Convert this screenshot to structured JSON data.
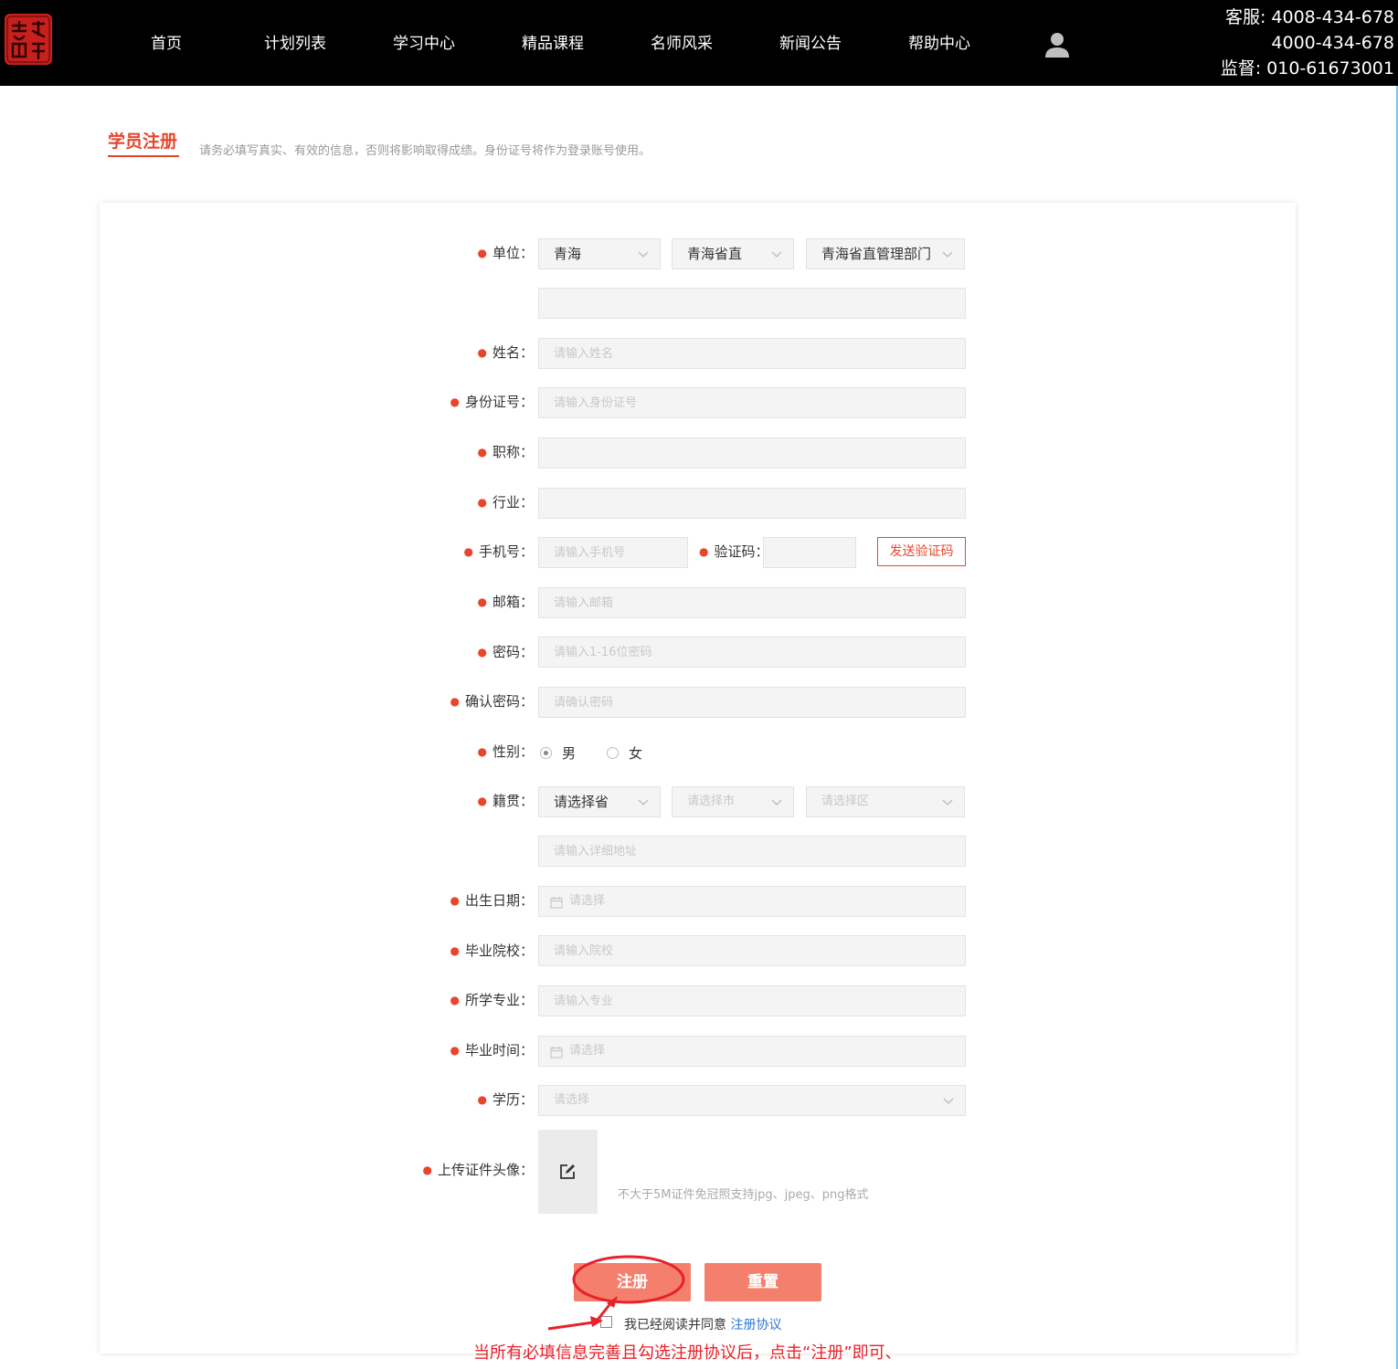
{
  "nav": {
    "items": [
      "首页",
      "计划列表",
      "学习中心",
      "精品课程",
      "名师风采",
      "新闻公告",
      "帮助中心"
    ]
  },
  "hotline": {
    "line1": "客服: 4008-434-678",
    "line2": "4000-434-678",
    "line3": "监督: 010-61673001"
  },
  "page": {
    "title": "学员注册",
    "description": "请务必填写真实、有效的信息，否则将影响取得成绩。身份证号将作为登录账号使用。"
  },
  "form": {
    "unit": {
      "label": "单位：",
      "province": "青海",
      "city": "青海省直",
      "dept": "青海省直管理部门"
    },
    "name": {
      "label": "姓名：",
      "placeholder": "请输入姓名"
    },
    "idcard": {
      "label": "身份证号：",
      "placeholder": "请输入身份证号"
    },
    "title_job": {
      "label": "职称："
    },
    "industry": {
      "label": "行业："
    },
    "phone": {
      "label": "手机号：",
      "placeholder": "请输入手机号"
    },
    "code": {
      "label": "验证码：",
      "send_label": "发送验证码"
    },
    "email": {
      "label": "邮箱：",
      "placeholder": "请输入邮箱"
    },
    "password": {
      "label": "密码：",
      "placeholder": "请输入1-16位密码"
    },
    "confirm": {
      "label": "确认密码：",
      "placeholder": "请确认密码"
    },
    "gender": {
      "label": "性别：",
      "male": "男",
      "female": "女",
      "selected": "男"
    },
    "hometown": {
      "label": "籍贯：",
      "province": "请选择省",
      "city": "请选择市",
      "district": "请选择区",
      "address_placeholder": "请输入详细地址"
    },
    "birth": {
      "label": "出生日期：",
      "placeholder": "请选择"
    },
    "school": {
      "label": "毕业院校：",
      "placeholder": "请输入院校"
    },
    "major": {
      "label": "所学专业：",
      "placeholder": "请输入专业"
    },
    "grad_time": {
      "label": "毕业时间：",
      "placeholder": "请选择"
    },
    "education": {
      "label": "学历：",
      "placeholder": "请选择"
    },
    "photo": {
      "label": "上传证件头像：",
      "hint": "不大于5M证件免冠照支持jpg、jpeg、png格式"
    }
  },
  "actions": {
    "register": "注册",
    "reset": "重置",
    "agree_text": "我已经阅读并同意",
    "agree_link": "注册协议"
  },
  "annotation": {
    "text": "当所有必填信息完善且勾选注册协议后，点击“注册”即可、"
  },
  "colors": {
    "accent": "#e8452c",
    "button": "#f47f6d",
    "link": "#2b7bd6",
    "annotation": "#e8212a"
  },
  "icons": {
    "user": "user-icon",
    "chevron": "chevron-down-icon",
    "calendar": "calendar-icon",
    "edit": "edit-icon"
  }
}
